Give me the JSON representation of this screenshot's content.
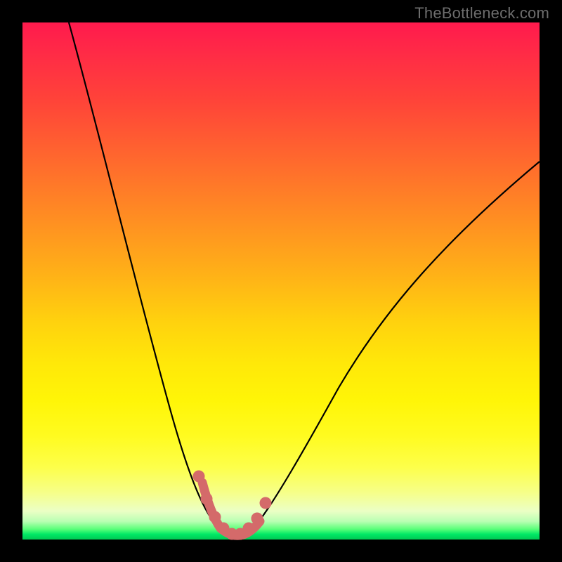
{
  "watermark": "TheBottleneck.com",
  "chart_data": {
    "type": "line",
    "title": "",
    "xlabel": "",
    "ylabel": "",
    "xlim": [
      0,
      100
    ],
    "ylim": [
      0,
      100
    ],
    "grid": false,
    "legend": false,
    "series": [
      {
        "name": "bottleneck-curve",
        "color": "#000000",
        "x": [
          9,
          12,
          15,
          18,
          21,
          24,
          27,
          30,
          32,
          34,
          35.5,
          37,
          38.5,
          40,
          42,
          44,
          48,
          52,
          56,
          60,
          64,
          68,
          72,
          76,
          80,
          84,
          88,
          92,
          96,
          100
        ],
        "y": [
          100,
          88,
          77,
          67,
          57,
          48,
          39,
          30,
          23,
          16,
          11,
          7,
          4,
          2,
          1,
          1,
          3,
          7,
          13,
          20,
          27,
          34,
          41,
          47,
          53,
          58,
          63,
          67,
          71,
          74
        ]
      },
      {
        "name": "valley-markers",
        "color": "#d46a6a",
        "style": "points",
        "x": [
          34.0,
          35.5,
          37.0,
          38.5,
          40.0,
          41.5,
          43.0,
          44.5,
          46.0
        ],
        "y": [
          12.0,
          8.0,
          4.5,
          2.5,
          1.5,
          1.5,
          2.5,
          4.5,
          8.0
        ]
      }
    ]
  },
  "colors": {
    "frame": "#000000",
    "curve": "#000000",
    "markers": "#d46a6a",
    "gradient_top": "#ff1a4d",
    "gradient_mid": "#ffe809",
    "gradient_bottom": "#00c853"
  }
}
